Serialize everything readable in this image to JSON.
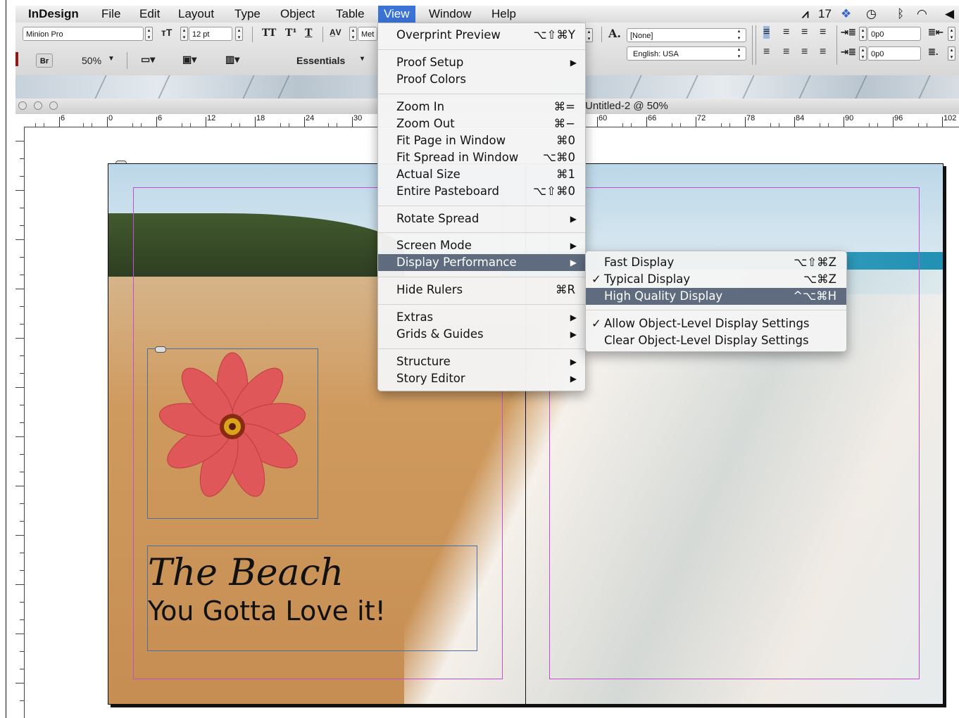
{
  "menubar": {
    "app": "InDesign",
    "items": [
      "File",
      "Edit",
      "Layout",
      "Type",
      "Object",
      "Table",
      "View",
      "Window",
      "Help"
    ],
    "active": "View",
    "right_badge": "17"
  },
  "control": {
    "font": "Minion Pro",
    "size": "12 pt",
    "kern": "Met",
    "style_none": "[None]",
    "language": "English: USA",
    "indent1": "0p0",
    "indent2": "0p0",
    "bridge": "Br",
    "zoom": "50%",
    "workspace": "Essentials",
    "caps_labels": [
      "TT",
      "T¹",
      "T"
    ]
  },
  "document": {
    "title": "Untitled-2 @ 50%",
    "ruler_labels": [
      "6",
      "0",
      "6",
      "12",
      "18",
      "24",
      "30",
      "60",
      "66",
      "72",
      "78",
      "84",
      "90",
      "96",
      "102"
    ]
  },
  "page": {
    "title_text": "The Beach",
    "subtitle_text": "You Gotta Love it!"
  },
  "view_menu": {
    "groups": [
      [
        {
          "label": "Overprint Preview",
          "shortcut": "⌥⇧⌘Y"
        }
      ],
      [
        {
          "label": "Proof Setup",
          "submenu": true
        },
        {
          "label": "Proof Colors"
        }
      ],
      [
        {
          "label": "Zoom In",
          "shortcut": "⌘="
        },
        {
          "label": "Zoom Out",
          "shortcut": "⌘−"
        },
        {
          "label": "Fit Page in Window",
          "shortcut": "⌘0"
        },
        {
          "label": "Fit Spread in Window",
          "shortcut": "⌥⌘0"
        },
        {
          "label": "Actual Size",
          "shortcut": "⌘1"
        },
        {
          "label": "Entire Pasteboard",
          "shortcut": "⌥⇧⌘0"
        }
      ],
      [
        {
          "label": "Rotate Spread",
          "submenu": true
        }
      ],
      [
        {
          "label": "Screen Mode",
          "submenu": true
        },
        {
          "label": "Display Performance",
          "submenu": true,
          "highlighted": true
        }
      ],
      [
        {
          "label": "Hide Rulers",
          "shortcut": "⌘R"
        }
      ],
      [
        {
          "label": "Extras",
          "submenu": true
        },
        {
          "label": "Grids & Guides",
          "submenu": true
        }
      ],
      [
        {
          "label": "Structure",
          "submenu": true
        },
        {
          "label": "Story Editor",
          "submenu": true
        }
      ]
    ]
  },
  "display_submenu": {
    "items": [
      {
        "label": "Fast Display",
        "shortcut": "⌥⇧⌘Z"
      },
      {
        "label": "Typical Display",
        "shortcut": "⌥⌘Z",
        "checked": true
      },
      {
        "label": "High Quality Display",
        "shortcut": "^⌥⌘H",
        "highlighted": true
      },
      {
        "label": "Allow Object-Level Display Settings",
        "checked": true
      },
      {
        "label": "Clear Object-Level Display Settings"
      }
    ]
  },
  "colors": {
    "menu_highlight": "#5f6c80",
    "menubar_active": "#3b73d6",
    "margin_guide": "#c54ed6",
    "frame_edge": "#4a6fa5"
  }
}
